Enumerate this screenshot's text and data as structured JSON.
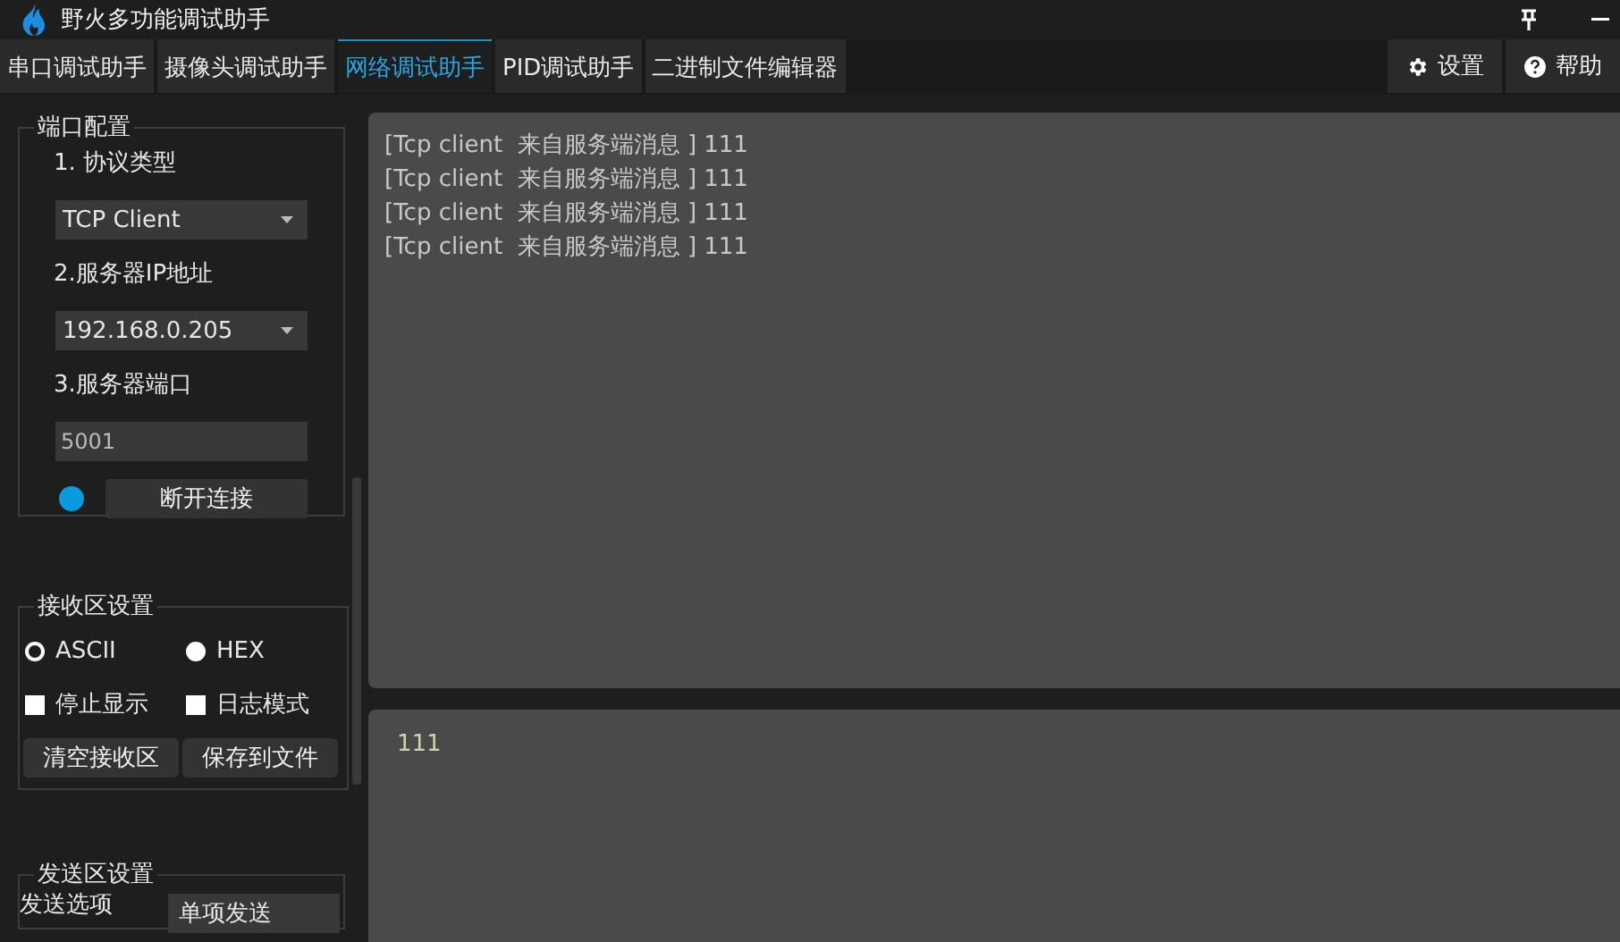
{
  "window": {
    "title": "野火多功能调试助手"
  },
  "tabs": [
    {
      "label": "串口调试助手",
      "selected": false
    },
    {
      "label": "摄像头调试助手",
      "selected": false
    },
    {
      "label": "网络调试助手",
      "selected": true
    },
    {
      "label": "PID调试助手",
      "selected": false
    },
    {
      "label": "二进制文件编辑器",
      "selected": false
    }
  ],
  "toolbar_buttons": [
    {
      "kind": "settings",
      "label": "设置"
    },
    {
      "kind": "help",
      "label": "帮助"
    }
  ],
  "port_config": {
    "title": "端口配置",
    "protocol_label": "1. 协议类型",
    "protocol": "TCP Client",
    "ip_label": "2.服务器IP地址",
    "ip": "192.168.0.205",
    "port_label": "3.服务器端口",
    "port": "5001",
    "connected": true,
    "connect_button": "断开连接"
  },
  "receive_settings": {
    "title": "接收区设置",
    "radios": [
      {
        "label": "ASCII",
        "selected": true
      },
      {
        "label": "HEX",
        "selected": false
      }
    ],
    "checkboxes": [
      {
        "label": "停止显示",
        "checked": false
      },
      {
        "label": "日志模式",
        "checked": false
      }
    ],
    "buttons": [
      "清空接收区",
      "保存到文件"
    ]
  },
  "send_settings": {
    "title": "发送区设置",
    "option_label": "发送选项",
    "option": "单项发送"
  },
  "receive_area": {
    "lines": [
      "[Tcp client  来自服务端消息 ] 111",
      "[Tcp client  来自服务端消息 ] 111",
      "[Tcp client  来自服务端消息 ] 111",
      "[Tcp client  来自服务端消息 ] 111"
    ]
  },
  "send_area": {
    "value": "111"
  }
}
